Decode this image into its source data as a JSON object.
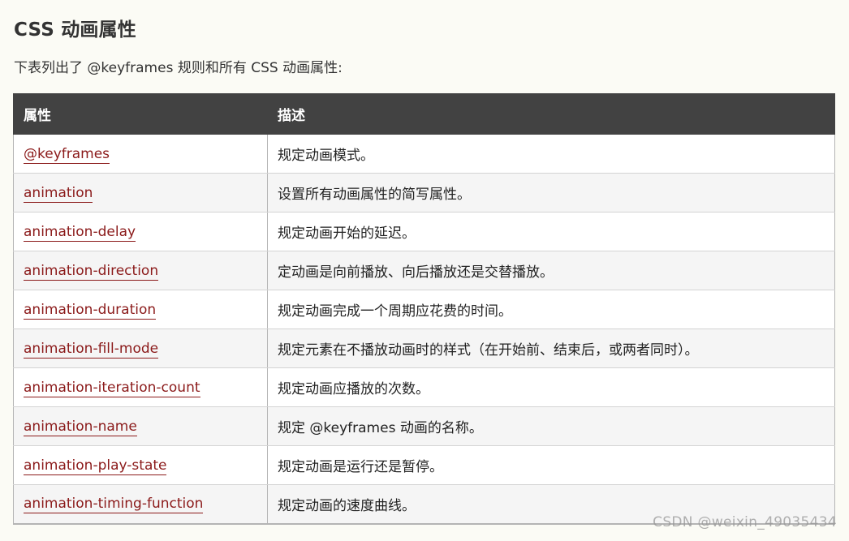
{
  "heading": "CSS 动画属性",
  "intro": "下表列出了 @keyframes 规则和所有 CSS 动画属性:",
  "table": {
    "headers": [
      "属性",
      "描述"
    ],
    "rows": [
      {
        "property": "@keyframes",
        "description": "规定动画模式。"
      },
      {
        "property": "animation",
        "description": "设置所有动画属性的简写属性。"
      },
      {
        "property": "animation-delay",
        "description": "规定动画开始的延迟。"
      },
      {
        "property": "animation-direction",
        "description": "定动画是向前播放、向后播放还是交替播放。"
      },
      {
        "property": "animation-duration",
        "description": "规定动画完成一个周期应花费的时间。"
      },
      {
        "property": "animation-fill-mode",
        "description": "规定元素在不播放动画时的样式（在开始前、结束后，或两者同时）。"
      },
      {
        "property": "animation-iteration-count",
        "description": "规定动画应播放的次数。"
      },
      {
        "property": "animation-name",
        "description": "规定 @keyframes 动画的名称。"
      },
      {
        "property": "animation-play-state",
        "description": "规定动画是运行还是暂停。"
      },
      {
        "property": "animation-timing-function",
        "description": "规定动画的速度曲线。"
      }
    ]
  },
  "watermark": "CSDN @weixin_49035434",
  "colors": {
    "header_bg": "#424242",
    "link": "#8b1a1a",
    "page_bg": "#fbfbf5",
    "row_alt": "#f5f5f5"
  }
}
